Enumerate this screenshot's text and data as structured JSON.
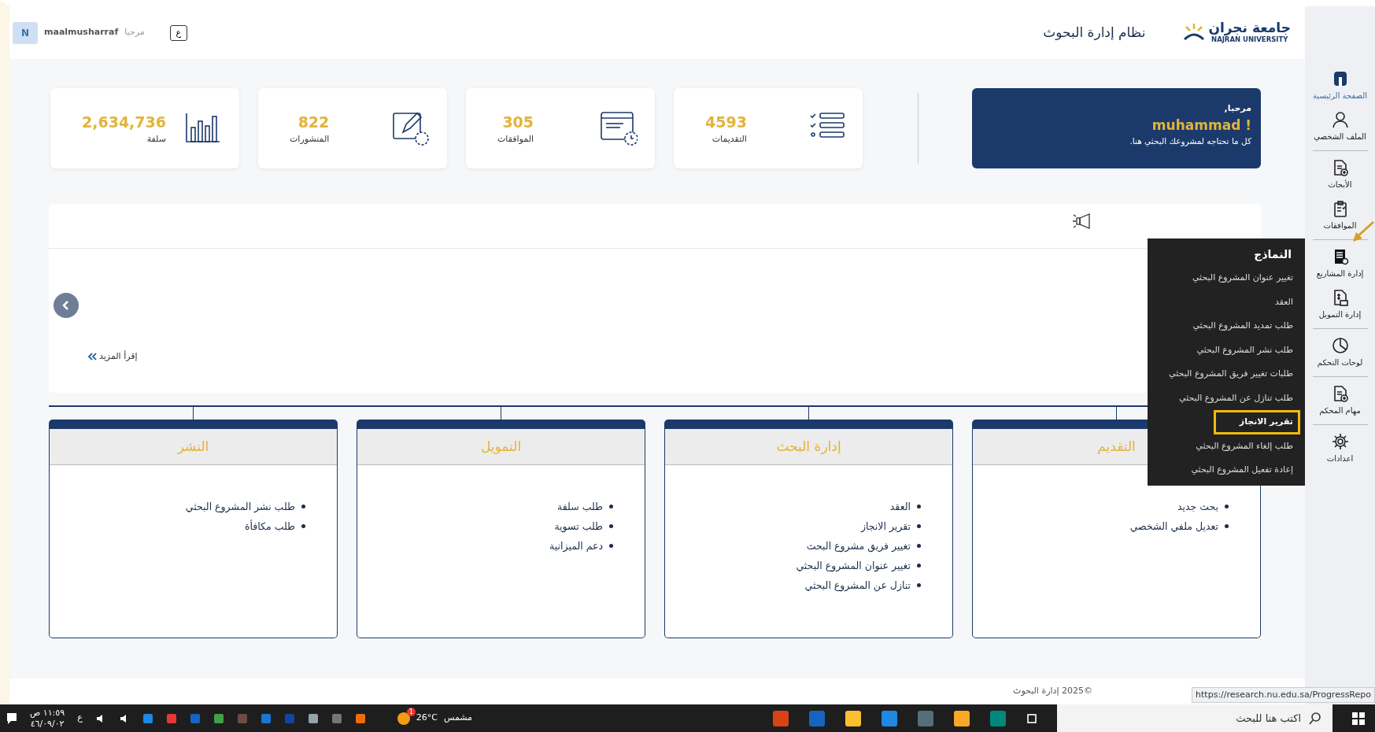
{
  "header": {
    "logo_arabic": "جامعة نجران",
    "logo_english": "NAJRAN UNIVERSITY",
    "title": "نظام إدارة البحوث",
    "greeting": "مرحبا",
    "username": "maalmusharraf",
    "avatar_initial": "N",
    "language_toggle": "ع"
  },
  "welcome": {
    "greeting": "مرحبا,",
    "name": "muhammad !",
    "subtitle": "كل ما تحتاجه لمشروعك البحثي هنا."
  },
  "stats": [
    {
      "kind": "list",
      "value": "4593",
      "label": "التقديمات"
    },
    {
      "kind": "window",
      "value": "305",
      "label": "الموافقات"
    },
    {
      "kind": "edit",
      "value": "822",
      "label": "المنشورات"
    },
    {
      "kind": "bars",
      "value": "2,634,736",
      "label": "سلفة"
    }
  ],
  "announcements": {
    "read_more": "إقرأ المزيد"
  },
  "categories": [
    {
      "title": "التقديم",
      "items": [
        "بحث جديد",
        "تعديل ملفي الشخصي"
      ]
    },
    {
      "title": "إدارة البحث",
      "items": [
        "العقد",
        "تقرير الانجاز",
        "تغيير فريق مشروع البحث",
        "تغيير عنوان المشروع البحثي",
        "تنازل عن المشروع البحثي"
      ]
    },
    {
      "title": "التمويل",
      "items": [
        "طلب سلفة",
        "طلب تسوية",
        "دعم الميزانية"
      ]
    },
    {
      "title": "النشر",
      "items": [
        "طلب نشر المشروع البحثي",
        "طلب مكافأة"
      ]
    }
  ],
  "sidebar": {
    "items": [
      {
        "kind": "home",
        "label": "الصفحة الرئيسية",
        "selected": true,
        "divider_after": false
      },
      {
        "kind": "user",
        "label": "الملف الشخصي",
        "selected": false,
        "divider_after": true
      },
      {
        "kind": "doc",
        "label": "الأبحاث",
        "selected": false,
        "divider_after": false
      },
      {
        "kind": "clipboard",
        "label": "الموافقات",
        "selected": false,
        "divider_after": true
      },
      {
        "kind": "project",
        "label": "إدارة المشاريع",
        "selected": false,
        "divider_after": false
      },
      {
        "kind": "money",
        "label": "إدارة التمويل",
        "selected": false,
        "divider_after": true
      },
      {
        "kind": "pie",
        "label": "لوحات التحكم",
        "selected": false,
        "divider_after": true
      },
      {
        "kind": "doc",
        "label": "مهام المحكم",
        "selected": false,
        "divider_after": true
      },
      {
        "kind": "gear",
        "label": "اعدادات",
        "selected": false,
        "divider_after": false
      }
    ]
  },
  "dropdown": {
    "title": "النماذج",
    "items": [
      {
        "label": "تغيير عنوان المشروع البحثي",
        "selected": false
      },
      {
        "label": "العقد",
        "selected": false
      },
      {
        "label": "طلب تمديد المشروع البحثي",
        "selected": false
      },
      {
        "label": "طلب نشر المشروع البحثي",
        "selected": false
      },
      {
        "label": "طلبات تغيير فريق المشروع البحثي",
        "selected": false
      },
      {
        "label": "طلب تنازل عن المشروع البحثي",
        "selected": false
      },
      {
        "label": "تقرير الانجاز",
        "selected": true
      },
      {
        "label": "طلب إلغاء المشروع البحثي",
        "selected": false
      },
      {
        "label": "إعادة تفعيل المشروع البحثي",
        "selected": false
      }
    ]
  },
  "footer": {
    "copyright": "©2025 إدارة البحوث"
  },
  "status_url": "https://research.nu.edu.sa/ProgressRepo",
  "taskbar": {
    "search_placeholder": "اكتب هنا للبحث",
    "weather_temp": "26°C",
    "weather_text": "مشمس",
    "weather_badge": "1",
    "lang": "ع",
    "time": "١١:٥٩ ص",
    "date": "٤٦/٠٩/٠٢"
  }
}
